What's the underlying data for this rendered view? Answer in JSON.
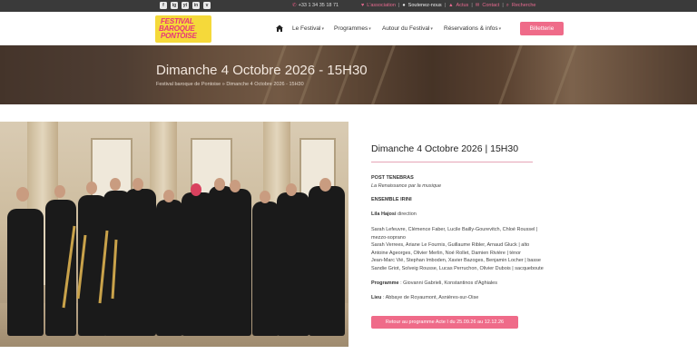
{
  "topbar": {
    "social": [
      "f",
      "ig",
      "yt",
      "in",
      "v"
    ],
    "phone": "+33 1 34 35 18 71",
    "links": [
      {
        "label": "L'association",
        "color": "#e86a90"
      },
      {
        "label": "Soutenez-nous",
        "color": "#eeeeee"
      },
      {
        "label": "Actus",
        "color": "#e86a90"
      },
      {
        "label": "Contact",
        "color": "#e86a90"
      },
      {
        "label": "Recherche",
        "color": "#e86a90"
      }
    ],
    "sep": "|"
  },
  "logo": {
    "line1": "FESTIVAL",
    "line2": "BAROQUE",
    "line3": "PONTOISE"
  },
  "nav": {
    "items": [
      "Le Festival",
      "Programmes",
      "Autour du Festival",
      "Réservations & infos"
    ],
    "billetterie": "Billetterie"
  },
  "hero": {
    "title": "Dimanche 4 Octobre 2026 - 15H30",
    "breadcrumb": "Festival baroque de Pontoise  »  Dimanche 4 Octobre 2026 - 15H30"
  },
  "event": {
    "date_title": "Dimanche 4 Octobre 2026 | 15H30",
    "program_title": "POST TENEBRAS",
    "subtitle": "La Renaissance par la musique",
    "ensemble": "ENSEMBLE IRINI",
    "director_name": "Lila Hajosi",
    "director_role": " direction",
    "performers": [
      "Sarah Lefeuvre, Clémence Faber, Lucile Bailly-Gourevitch, Chloé Roussel |",
      "mezzo-soprano",
      "Sarah Verrees, Ariane Le Fournis, Guillaume Ribler, Arnaud Gluck | alto",
      "Antoine Ageorges, Olivier Merlin, Noé Rollet, Damien Rivière | ténor",
      "Jean-Marc Vié, Stephan Imboden, Xavier Bazoges, Benjamin Locher | basse",
      "Sandie Griot, Solveig Rousse, Lucas Perruchon, Olivier Dubois | sacqueboute"
    ],
    "programme_label": "Programme",
    "programme_value": " : Giovanni Gabrieli, Konstantinos d'Aghiales",
    "lieu_label": "Lieu",
    "lieu_value": " : Abbaye de Royaumont, Asnières-sur-Oise",
    "back_button": "Retour au programme Acte I du 25.09.26 au 12.12.26"
  },
  "colors": {
    "accent": "#ef6b89",
    "topbar": "#3a3a3a"
  }
}
